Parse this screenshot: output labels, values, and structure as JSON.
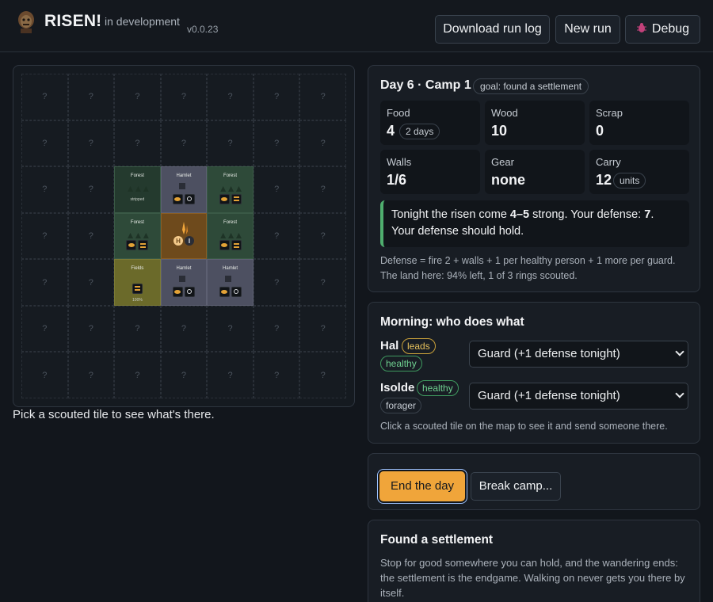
{
  "header": {
    "title": "RISEN!",
    "tag": "in development",
    "version": "v0.0.23",
    "buttons": {
      "download": "Download run log",
      "new_run": "New run",
      "debug": "Debug"
    }
  },
  "map": {
    "unknown_glyph": "?",
    "caption": "Pick a scouted tile to see what's there.",
    "tiles": {
      "forest_stripped": {
        "name": "Forest",
        "note": "stripped"
      },
      "hamlet_top": {
        "name": "Hamlet"
      },
      "forest_top_right": {
        "name": "Forest"
      },
      "forest_mid_left": {
        "name": "Forest"
      },
      "camp": {
        "leader_initial": "H",
        "member_initial": "I"
      },
      "forest_mid_right": {
        "name": "Forest"
      },
      "fields": {
        "name": "Fields",
        "note": "100%"
      },
      "hamlet_bottom": {
        "name": "Hamlet"
      },
      "hamlet_bottom_right": {
        "name": "Hamlet"
      }
    }
  },
  "status": {
    "day_title": "Day 6 · Camp 1",
    "goal": "goal: found a settlement",
    "stats": {
      "food": {
        "label": "Food",
        "value": "4",
        "extra": "2 days"
      },
      "wood": {
        "label": "Wood",
        "value": "10"
      },
      "scrap": {
        "label": "Scrap",
        "value": "0"
      },
      "walls": {
        "label": "Walls",
        "value": "1/6"
      },
      "gear": {
        "label": "Gear",
        "value": "none"
      },
      "carry": {
        "label": "Carry",
        "value": "12",
        "extra": "units"
      }
    },
    "alert": {
      "prefix": "Tonight the risen come ",
      "strength": "4–5",
      "middle": " strong. Your defense: ",
      "defense": "7",
      "suffix": ".",
      "line2": "Your defense should hold."
    },
    "formula_line1": "Defense = fire 2 + walls + 1 per healthy person + 1 more per guard.",
    "formula_line2": "The land here: 94% left, 1 of 3 rings scouted."
  },
  "morning": {
    "title": "Morning: who does what",
    "people": [
      {
        "name": "Hal",
        "tags": [
          "leads",
          "healthy"
        ],
        "assignment": "Guard (+1 defense tonight)"
      },
      {
        "name": "Isolde",
        "tags": [
          "healthy",
          "forager"
        ],
        "assignment": "Guard (+1 defense tonight)"
      }
    ],
    "help": "Click a scouted tile on the map to see it and send someone there."
  },
  "actions": {
    "end_day": "End the day",
    "break_camp": "Break camp..."
  },
  "settlement": {
    "title": "Found a settlement",
    "text": "Stop for good somewhere you can hold, and the wandering ends: the settlement is the endgame. Walking on never gets you there by itself."
  },
  "colors": {
    "accent": "#f0a53a",
    "healthy": "#4fae6e",
    "leads": "#c9a13a",
    "forest": "#2e4a39",
    "hamlet": "#4d5061",
    "fields": "#6b6a2a",
    "camp": "#6e4a1c"
  }
}
